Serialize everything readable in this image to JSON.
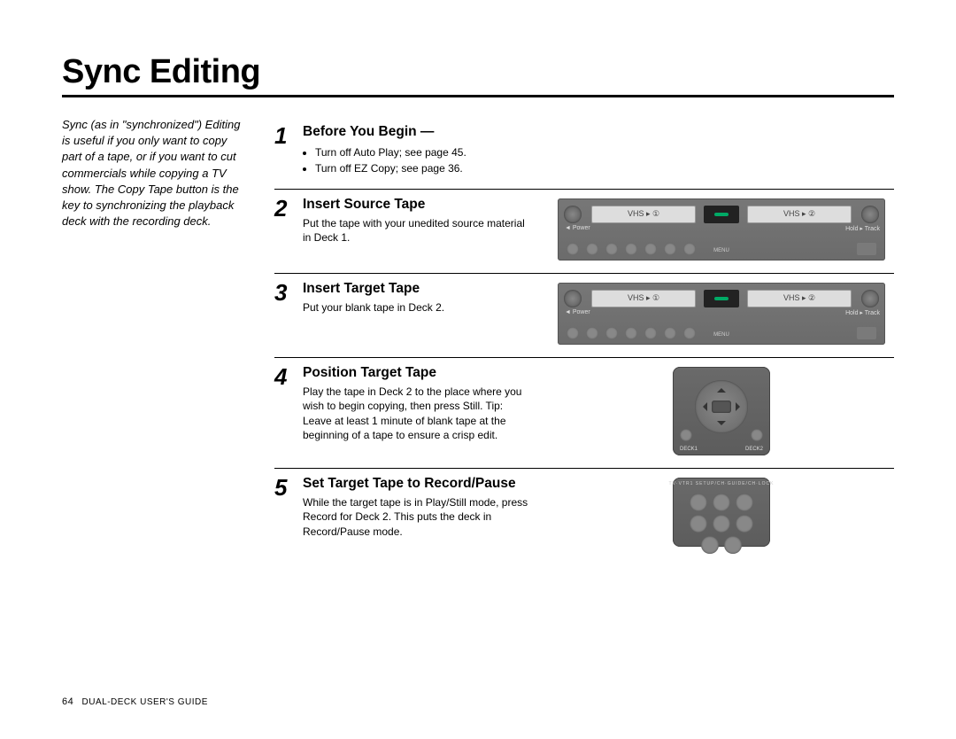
{
  "page": {
    "title": "Sync Editing",
    "intro": "Sync (as in \"synchronized\") Editing is useful if you only want to copy part of a tape, or if you want to cut commercials while copying a TV show. The Copy Tape button is the key to synchronizing the playback deck with the recording deck.",
    "footer_page": "64",
    "footer_text": "DUAL-DECK USER'S GUIDE"
  },
  "steps": [
    {
      "num": "1",
      "heading": "Before You Begin —",
      "bullets": [
        "Turn off Auto Play; see page 45.",
        "Turn off EZ Copy; see page 36."
      ],
      "desc": "",
      "illus": "none"
    },
    {
      "num": "2",
      "heading": "Insert Source Tape",
      "desc": "Put the tape with your unedited source material in Deck 1.",
      "bullets": [],
      "illus": "vcr"
    },
    {
      "num": "3",
      "heading": "Insert Target Tape",
      "desc": "Put your blank tape in Deck 2.",
      "bullets": [],
      "illus": "vcr"
    },
    {
      "num": "4",
      "heading": "Position Target Tape",
      "desc": "Play the tape in Deck 2 to the place where you wish to begin copying, then press Still. Tip: Leave at least 1 minute of blank tape at the beginning of a tape to ensure a crisp edit.",
      "bullets": [],
      "illus": "remote-dpad"
    },
    {
      "num": "5",
      "heading": "Set Target Tape to Record/Pause",
      "desc": "While the target tape is in Play/Still mode, press Record for Deck 2. This puts the deck in Record/Pause mode.",
      "bullets": [],
      "illus": "remote-grid"
    }
  ],
  "vcr": {
    "slot1_label": "VHS ▸ ①",
    "slot2_label": "VHS ▸ ②",
    "cap_left": "◄ Power",
    "cap_right": "Hold ▸ Track",
    "mid_label": "MENU",
    "deck1_caption": "DECK1",
    "deck2_caption": "DECK2",
    "remote2_arc": "TV·VTR1    SETUP/CH·GUIDE/CH·LOCK"
  }
}
